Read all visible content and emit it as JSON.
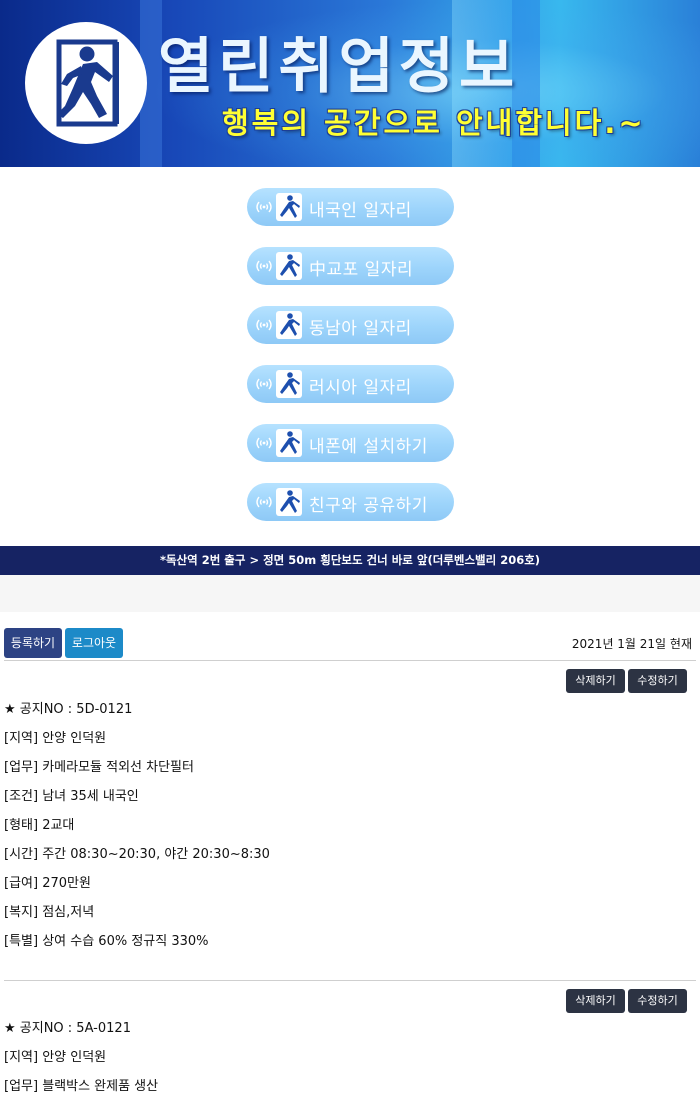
{
  "banner": {
    "title": "열린취업정보",
    "subtitle": "행복의 공간으로 안내합니다.~"
  },
  "menu": [
    {
      "label": "내국인 일자리"
    },
    {
      "label": "中교포 일자리"
    },
    {
      "label": "동남아 일자리"
    },
    {
      "label": "러시아 일자리"
    },
    {
      "label": "내폰에 설치하기"
    },
    {
      "label": "친구와 공유하기"
    }
  ],
  "address": "*독산역 2번 출구 > 정면 50m 횡단보도 건너 바로 앞(더루벤스밸리 206호)",
  "actions": {
    "register": "등록하기",
    "logout": "로그아웃",
    "date": "2021년 1월 21일 현재"
  },
  "postings": [
    {
      "delete_label": "삭제하기",
      "edit_label": "수정하기",
      "lines": [
        "★ 공지NO : 5D-0121",
        "[지역] 안양 인덕원",
        "[업무] 카메라모듈 적외선 차단필터",
        "[조건] 남녀 35세 내국인",
        "[형태] 2교대",
        "[시간] 주간 08:30~20:30, 야간 20:30~8:30",
        "[급여] 270만원",
        "[복지] 점심,저녁",
        "[특별] 상여 수습 60% 정규직 330%"
      ]
    },
    {
      "delete_label": "삭제하기",
      "edit_label": "수정하기",
      "lines": [
        "★ 공지NO : 5A-0121",
        "[지역] 안양 인덕원",
        "[업무] 블랙박스 완제품 생산"
      ]
    }
  ],
  "colors": {
    "address_bar": "#162363",
    "register_button": "#2d4384",
    "logout_button": "#1c8ac8",
    "dark_button": "#2c3343",
    "menu_button": "#9dd4fb",
    "subtitle_text": "#ffff33"
  }
}
